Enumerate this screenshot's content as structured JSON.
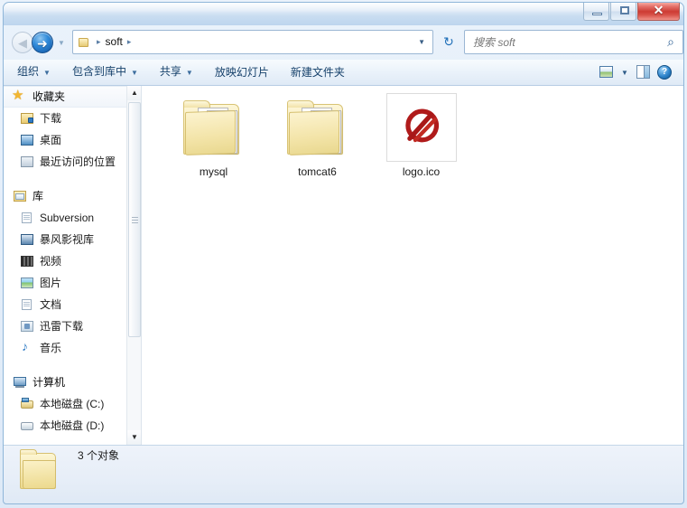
{
  "window": {
    "buttons": {
      "minimize": "minimize",
      "maximize": "maximize",
      "close": "✕"
    }
  },
  "navigation": {
    "back_label": "◀",
    "forward_label": "➜",
    "history_caret": "▼",
    "refresh_label": "↻",
    "address": {
      "crumbs": [
        "soft"
      ],
      "separator": "▸",
      "dropdown_caret": "▼"
    }
  },
  "search": {
    "placeholder": "搜索 soft",
    "icon": "⌕"
  },
  "toolbar": {
    "items": [
      {
        "label": "组织",
        "caret": "▼"
      },
      {
        "label": "包含到库中",
        "caret": "▼"
      },
      {
        "label": "共享",
        "caret": "▼"
      },
      {
        "label": "放映幻灯片",
        "caret": ""
      },
      {
        "label": "新建文件夹",
        "caret": ""
      }
    ],
    "views_caret": "▼",
    "help_label": "?"
  },
  "sidebar": {
    "groups": [
      {
        "root": {
          "label": "收藏夹",
          "icon": "star-icon",
          "selected": true
        },
        "items": [
          {
            "label": "下载",
            "icon": "downloads-icon"
          },
          {
            "label": "桌面",
            "icon": "desktop-icon"
          },
          {
            "label": "最近访问的位置",
            "icon": "recent-places-icon"
          }
        ]
      },
      {
        "root": {
          "label": "库",
          "icon": "library-icon",
          "selected": false
        },
        "items": [
          {
            "label": "Subversion",
            "icon": "document-icon"
          },
          {
            "label": "暴风影视库",
            "icon": "video-library-icon"
          },
          {
            "label": "视频",
            "icon": "film-icon"
          },
          {
            "label": "图片",
            "icon": "pictures-icon"
          },
          {
            "label": "文档",
            "icon": "document-icon"
          },
          {
            "label": "迅雷下载",
            "icon": "thunder-download-icon"
          },
          {
            "label": "音乐",
            "icon": "music-icon"
          }
        ]
      },
      {
        "root": {
          "label": "计算机",
          "icon": "computer-icon",
          "selected": false
        },
        "items": [
          {
            "label": "本地磁盘 (C:)",
            "icon": "system-drive-icon"
          },
          {
            "label": "本地磁盘 (D:)",
            "icon": "drive-icon"
          }
        ]
      }
    ],
    "scroll": {
      "up": "▲",
      "down": "▼"
    }
  },
  "content": {
    "items": [
      {
        "name": "mysql",
        "type": "folder"
      },
      {
        "name": "tomcat6",
        "type": "folder-preview"
      },
      {
        "name": "logo.ico",
        "type": "ico"
      }
    ]
  },
  "status": {
    "text": "3 个对象",
    "icon": "folder-icon"
  },
  "colors": {
    "close_button": "#cd3b33",
    "accent_blue": "#16416b",
    "folder_yellow": "#f1e0a0",
    "logo_red": "#b01b1b"
  }
}
